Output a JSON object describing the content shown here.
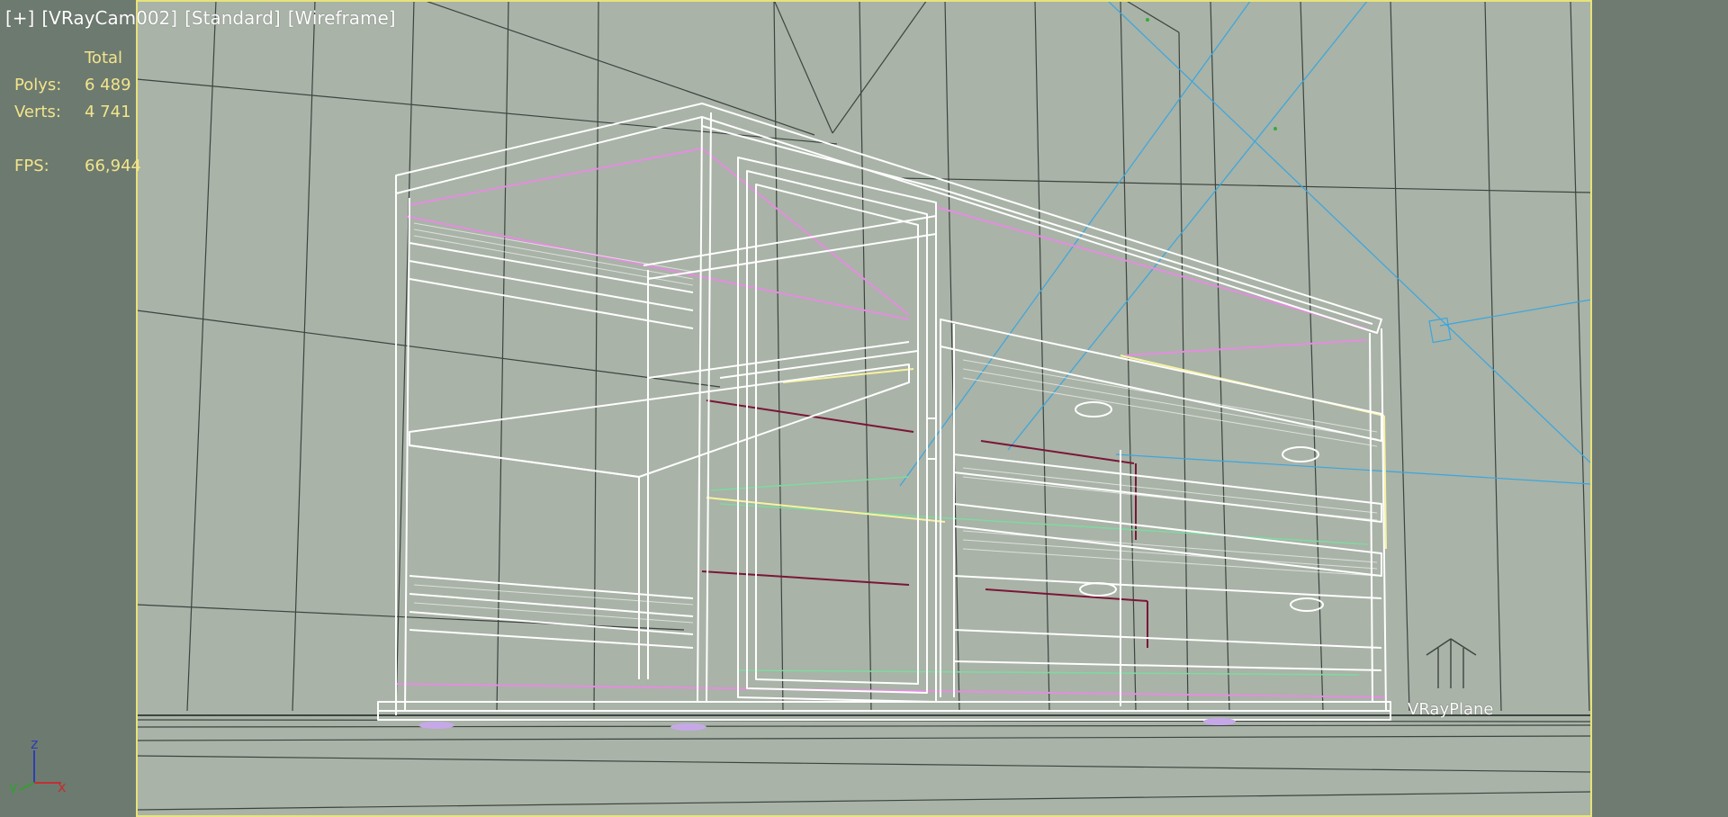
{
  "viewport": {
    "label_plus": "[+]",
    "label_camera": "[VRayCam002]",
    "label_shading_standard": "[Standard]",
    "label_shading_mode": "[Wireframe]"
  },
  "stats": {
    "header_total": "Total",
    "polys_label": "Polys:",
    "polys_value": "6 489",
    "verts_label": "Verts:",
    "verts_value": "4 741",
    "fps_label": "FPS:",
    "fps_value": "66,944"
  },
  "scene": {
    "object_label": "VRayPlane"
  },
  "axis_gizmo": {
    "z": "z",
    "y": "y",
    "x": "x"
  },
  "colors": {
    "viewport_bg": "#a9b3a7",
    "outer_bg": "#6f7a70",
    "active_border": "#e8e37a",
    "stats_text": "#f2e58a",
    "wire_white": "#ffffff",
    "wire_pink": "#e48de0",
    "wire_maroon": "#7a1638",
    "wire_green": "#7fd9a0",
    "wire_yellow": "#f7f2a0",
    "grid_line": "#3d4440",
    "camera_line": "#39a6e0"
  }
}
